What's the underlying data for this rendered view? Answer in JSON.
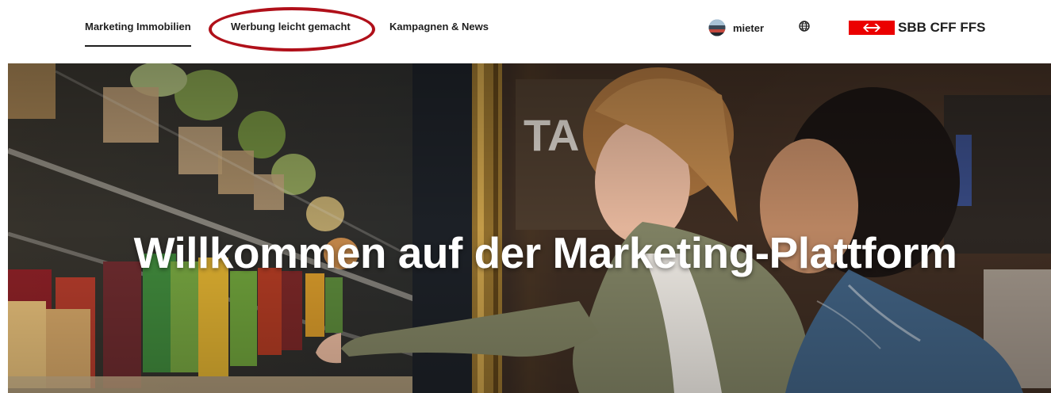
{
  "header": {
    "nav": [
      {
        "label": "Marketing Immobilien",
        "active": true
      },
      {
        "label": "Werbung leicht gemacht",
        "active": false,
        "highlighted": true
      },
      {
        "label": "Kampagnen & News",
        "active": false
      }
    ],
    "user_link_label": "mieter",
    "language_icon": "globe-icon",
    "logo_text": "SBB CFF FFS",
    "logo_color": "#eb0000"
  },
  "hero": {
    "title": "Willkommen auf der Marketing-Plattform"
  },
  "colors": {
    "highlight_ellipse": "#b0101a",
    "text": "#1f1f1f"
  }
}
